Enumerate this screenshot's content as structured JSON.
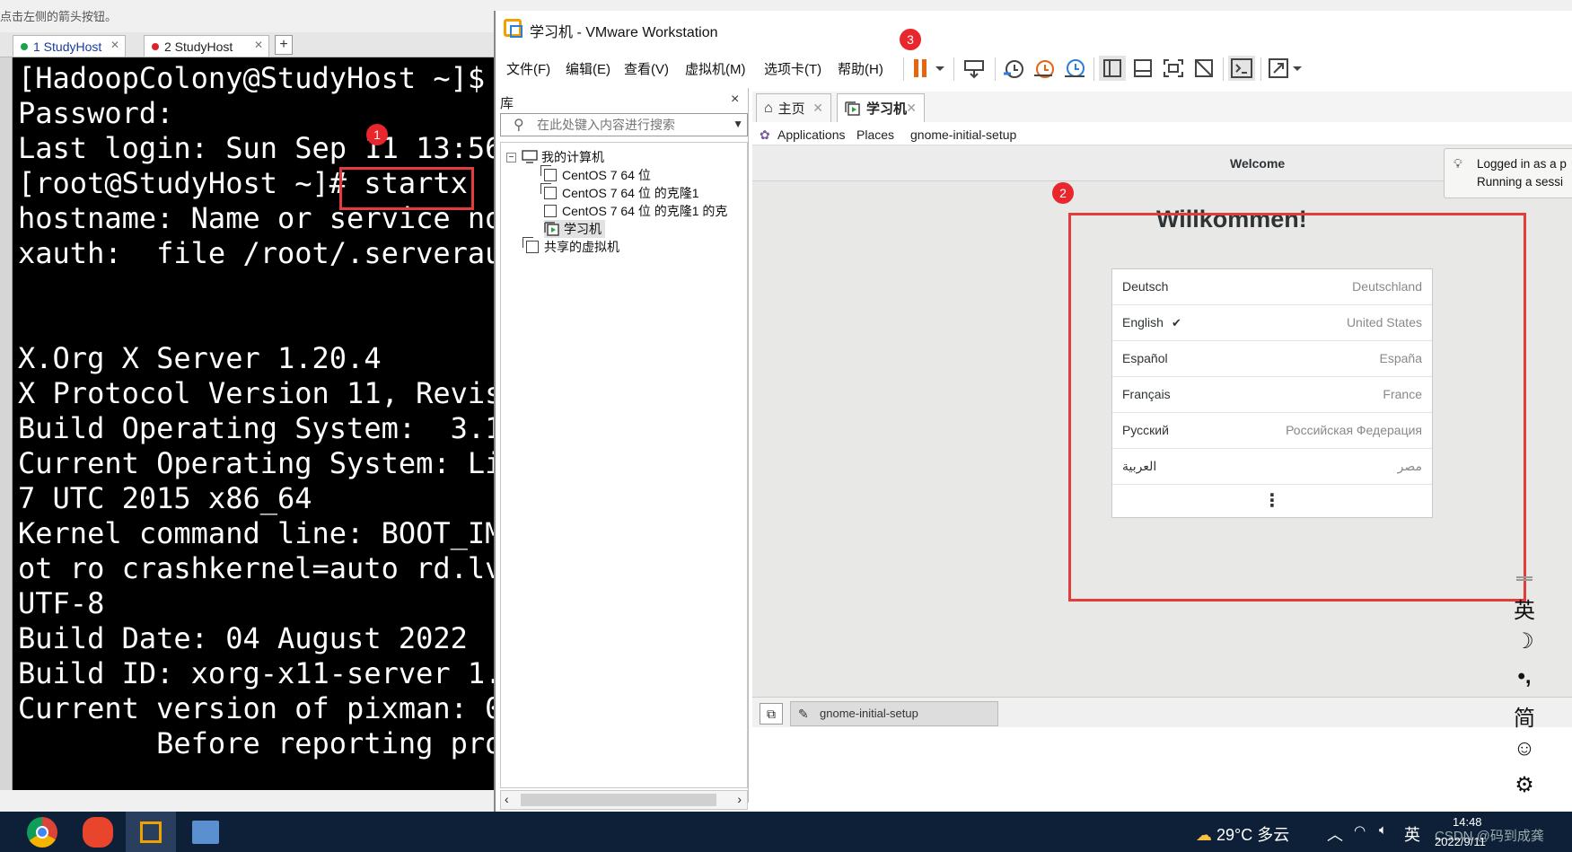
{
  "hint_text": "点击左侧的箭头按钮。",
  "terminal": {
    "tabs": [
      {
        "label": "1 StudyHost",
        "dot_color": "#1aa34a"
      },
      {
        "label": "2 StudyHost",
        "dot_color": "#e0202a"
      }
    ],
    "plus": "+",
    "lines": [
      "[HadoopColony@StudyHost ~]$ ",
      "Password:",
      "Last login: Sun Sep 11 13:56",
      "[root@StudyHost ~]# startx",
      "hostname: Name or service no",
      "xauth:  file /root/.serverau",
      "",
      "",
      "X.Org X Server 1.20.4",
      "X Protocol Version 11, Revis",
      "Build Operating System:  3.1",
      "Current Operating System: Li",
      "7 UTC 2015 x86_64",
      "Kernel command line: BOOT_IM",
      "ot ro crashkernel=auto rd.lv",
      "UTF-8",
      "Build Date: 04 August 2022",
      "Build ID: xorg-x11-server 1.",
      "Current version of pixman: 0",
      "        Before reporting pro"
    ],
    "badge1": "1"
  },
  "vmware": {
    "title": "学习机 - VMware Workstation",
    "menus": [
      "文件(F)",
      "编辑(E)",
      "查看(V)",
      "虚拟机(M)",
      "选项卡(T)",
      "帮助(H)"
    ],
    "badge3": "3",
    "library": {
      "heading": "库",
      "close": "×",
      "search_placeholder": "在此处键入内容进行搜索",
      "root": "我的计算机",
      "items": [
        "CentOS 7 64 位",
        "CentOS 7 64 位 的克隆1",
        "CentOS 7 64 位 的克隆1 的克",
        "学习机"
      ],
      "shared": "共享的虚拟机"
    },
    "tabs": [
      {
        "label": "主页"
      },
      {
        "label": "学习机"
      }
    ],
    "gnome_bar": {
      "applications": "Applications",
      "places": "Places",
      "app_name": "gnome-initial-setup"
    },
    "welcome_title": "Welcome",
    "notification": {
      "line1": "Logged in as a p",
      "line2": "Running a sessi"
    },
    "badge2": "2",
    "greeting": "Willkommen!",
    "languages": [
      {
        "name": "Deutsch",
        "country": "Deutschland",
        "selected": false
      },
      {
        "name": "English",
        "country": "United States",
        "selected": true
      },
      {
        "name": "Español",
        "country": "España",
        "selected": false
      },
      {
        "name": "Français",
        "country": "France",
        "selected": false
      },
      {
        "name": "Русский",
        "country": "Российская Федерация",
        "selected": false
      },
      {
        "name": "العربية",
        "country": "مصر",
        "selected": false
      }
    ],
    "more": "⋮",
    "ime": [
      "英",
      "☽",
      "•,",
      "简",
      "☺",
      "⚙"
    ],
    "status_task": "gnome-initial-setup"
  },
  "taskbar": {
    "weather": "29°C 多云",
    "ime_lang": "英",
    "time": "14:48",
    "date": "2022/9/11",
    "watermark": "CSDN @码到成龚"
  }
}
